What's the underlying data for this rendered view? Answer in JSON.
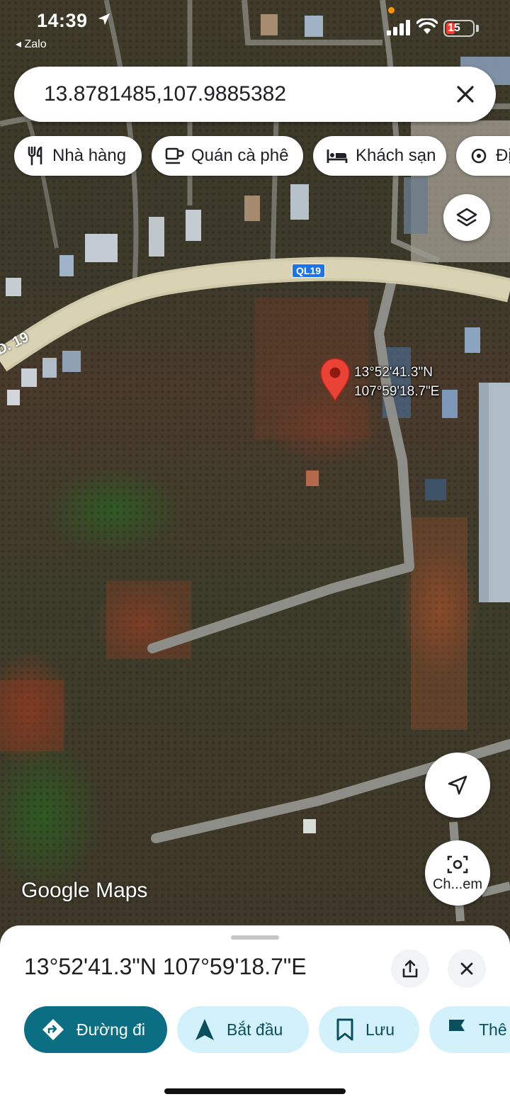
{
  "status_bar": {
    "time": "14:39",
    "back_app": "Zalo",
    "battery": "15",
    "battery_color": "#ff3b30",
    "icons": [
      "location-arrow-icon",
      "signal-icon",
      "wifi-icon",
      "battery-icon"
    ]
  },
  "search": {
    "query": "13.8781485,107.9885382",
    "clear_icon": "close-icon"
  },
  "chips": [
    {
      "label": "Nhà hàng",
      "icon": "restaurant-icon"
    },
    {
      "label": "Quán cà phê",
      "icon": "coffee-icon"
    },
    {
      "label": "Khách sạn",
      "icon": "hotel-icon"
    },
    {
      "label": "Đị",
      "icon": "attraction-icon"
    }
  ],
  "map": {
    "pin_label_lat": "13°52'41.3\"N",
    "pin_label_lng": "107°59'18.7\"E",
    "road_shield": "QL19",
    "road_name": "D. 19",
    "logo": "Google Maps",
    "pin_color": "#ea4335",
    "layers_icon": "layers-icon",
    "mylocation_icon": "navigation-arrow-icon",
    "lens_icon": "camera-search-icon",
    "lens_label": "Ch...em"
  },
  "sheet": {
    "title": "13°52'41.3\"N 107°59'18.7\"E",
    "share_icon": "share-icon",
    "close_icon": "close-icon",
    "actions": [
      {
        "label": "Đường đi",
        "icon": "directions-icon",
        "style": "primary"
      },
      {
        "label": "Bắt đầu",
        "icon": "navigation-icon",
        "style": "secondary"
      },
      {
        "label": "Lưu",
        "icon": "bookmark-icon",
        "style": "secondary"
      },
      {
        "label": "Thê",
        "icon": "flag-icon",
        "style": "secondary"
      }
    ],
    "primary_color": "#0b6e82",
    "secondary_color": "#d3f1fa"
  }
}
